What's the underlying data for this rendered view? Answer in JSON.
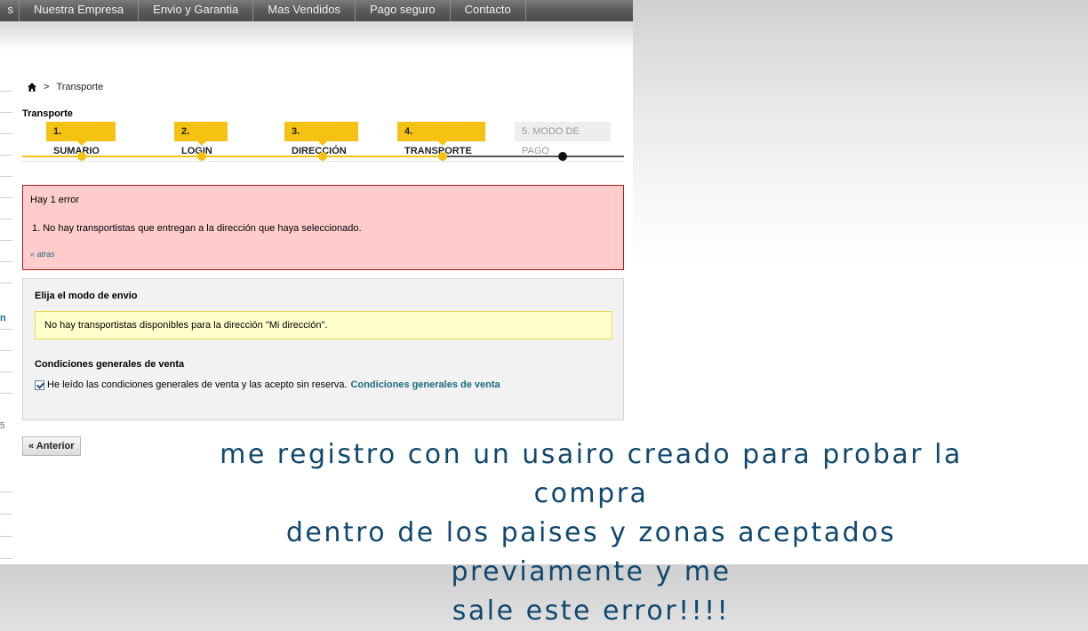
{
  "topnav": {
    "first_partial": "s",
    "items": [
      "Nuestra Empresa",
      "Envio y Garantia",
      "Mas Vendidos",
      "Pago seguro",
      "Contacto"
    ]
  },
  "sidebar": {
    "partial_letter_1": "n",
    "partial_letter_2": "5"
  },
  "breadcrumb": {
    "separator": ">",
    "current": "Transporte",
    "icon": "home-icon"
  },
  "page_title": "Transporte",
  "steps": {
    "items": [
      {
        "label": "1. SUMARIO",
        "state": "done"
      },
      {
        "label": "2. LOGIN",
        "state": "done"
      },
      {
        "label": "3. DIRECCIÓN",
        "state": "done"
      },
      {
        "label": "4. TRANSPORTE",
        "state": "current"
      },
      {
        "label": "5. MODO DE PAGO",
        "state": "pending"
      }
    ],
    "colors": {
      "active": "#f5c214",
      "inactive": "#eeeeee",
      "track_pending": "#555555"
    }
  },
  "error": {
    "title": "Hay 1 error",
    "items": [
      "1.  No hay transportistas que entregan a la dirección que haya seleccionado."
    ],
    "back_link": "« atras",
    "colors": {
      "background": "#ffcccc",
      "border": "#a51b1b"
    }
  },
  "carrier": {
    "heading": "Elija el modo de envio",
    "warning": "No hay transportistas disponibles para la dirección \"Mi dirección\".",
    "terms_heading": "Condiciones generales de venta",
    "terms_checkbox_checked": true,
    "terms_text": "He leído las condiciones generales de venta y las acepto sin reserva.",
    "terms_link": "Condiciones generales de venta"
  },
  "buttons": {
    "previous": "« Anterior"
  },
  "annotation": {
    "line1": "me registro con un usairo creado para probar la compra",
    "line2": "dentro de los paises y zonas aceptados previamente y me",
    "line3": "sale este error!!!!",
    "color": "#10486e"
  }
}
